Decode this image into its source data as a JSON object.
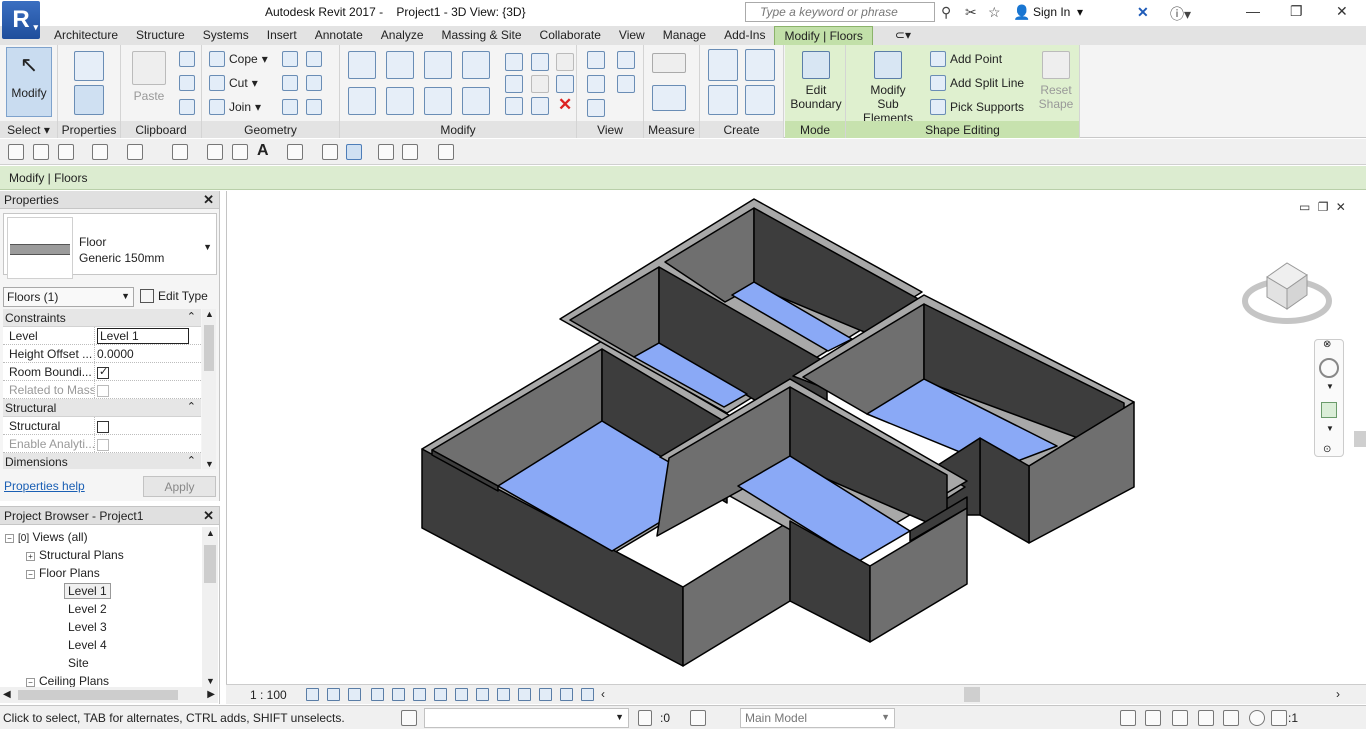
{
  "app": {
    "logo_letter": "R",
    "title": "Autodesk Revit 2017 -",
    "document": "Project1 - 3D View: {3D}",
    "search_placeholder": "Type a keyword or phrase",
    "sign_in": "Sign In"
  },
  "tabs": [
    "Architecture",
    "Structure",
    "Systems",
    "Insert",
    "Annotate",
    "Analyze",
    "Massing & Site",
    "Collaborate",
    "View",
    "Manage",
    "Add-Ins",
    "Modify | Floors"
  ],
  "active_tab": "Modify | Floors",
  "ribbon": {
    "select": {
      "button": "Modify",
      "label": "Select"
    },
    "properties": {
      "label": "Properties"
    },
    "clipboard": {
      "paste": "Paste",
      "label": "Clipboard"
    },
    "geometry": {
      "cope": "Cope",
      "cut": "Cut",
      "join": "Join",
      "label": "Geometry"
    },
    "modify": {
      "label": "Modify"
    },
    "view": {
      "label": "View"
    },
    "measure": {
      "label": "Measure"
    },
    "create": {
      "label": "Create"
    },
    "mode": {
      "edit_boundary_1": "Edit",
      "edit_boundary_2": "Boundary",
      "label": "Mode"
    },
    "shape_editing": {
      "modify_sub_1": "Modify",
      "modify_sub_2": "Sub Elements",
      "add_point": "Add Point",
      "add_split_line": "Add Split Line",
      "pick_supports": "Pick Supports",
      "reset_1": "Reset",
      "reset_2": "Shape",
      "label": "Shape Editing"
    }
  },
  "context_bar": "Modify | Floors",
  "properties": {
    "title": "Properties",
    "type_family": "Floor",
    "type_name": "Generic 150mm",
    "filter": "Floors (1)",
    "edit_type": "Edit Type",
    "groups": [
      {
        "name": "Constraints",
        "rows": [
          {
            "key": "Level",
            "value": "Level 1"
          },
          {
            "key": "Height Offset ...",
            "value": "0.0000"
          },
          {
            "key": "Room Boundi...",
            "value": ""
          },
          {
            "key": "Related to Mass",
            "value": ""
          }
        ]
      },
      {
        "name": "Structural",
        "rows": [
          {
            "key": "Structural",
            "value": ""
          },
          {
            "key": "Enable Analyti...",
            "value": ""
          }
        ]
      },
      {
        "name": "Dimensions",
        "rows": []
      }
    ],
    "help": "Properties help",
    "apply": "Apply"
  },
  "browser": {
    "title": "Project Browser - Project1",
    "views_all": "Views (all)",
    "structural_plans": "Structural Plans",
    "floor_plans": "Floor Plans",
    "levels": [
      "Level 1",
      "Level 2",
      "Level 3",
      "Level 4",
      "Site"
    ],
    "ceiling_plans": "Ceiling Plans"
  },
  "viewbar": {
    "scale": "1 : 100"
  },
  "status": {
    "hint": "Click to select, TAB for alternates, CTRL adds, SHIFT unselects.",
    "zero": ":0",
    "model": "Main Model",
    "filter_count": ":1"
  },
  "colors": {
    "floor": "#8aa9f6",
    "wall_dark": "#3b3b3b",
    "wall_mid": "#717171",
    "wall_top": "#b5b5b5",
    "context_green": "#c2e0a9"
  }
}
